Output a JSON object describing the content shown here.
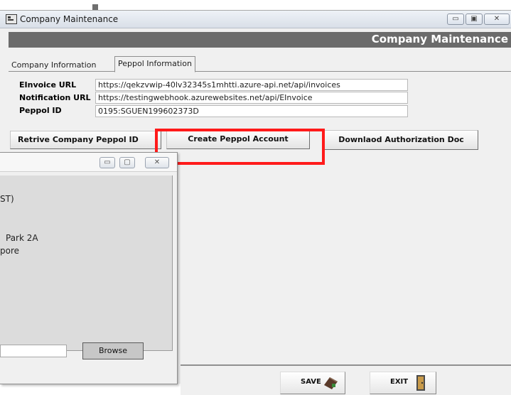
{
  "window": {
    "title": "Company Maintenance",
    "header": "Company Maintenance"
  },
  "tabs": [
    {
      "label": "Company Information",
      "active": false
    },
    {
      "label": "Peppol Information",
      "active": true
    }
  ],
  "peppol": {
    "einvoice_label": "EInvoice URL",
    "einvoice_value": "https://qekzvwip-40lv32345s1mhtti.azure-api.net/api/invoices",
    "notification_label": "Notification URL",
    "notification_value": "https://testingwebhook.azurewebsites.net/api/EInvoice",
    "peppol_id_label": "Peppol ID",
    "peppol_id_value": "0195:SGUEN199602373D"
  },
  "buttons": {
    "retrieve": "Retrive Company Peppol ID",
    "create": "Create Peppol Account",
    "download": "Downlaod Authorization Doc"
  },
  "child_window": {
    "line1": "ST)",
    "line2": "Park 2A",
    "line3": "pore",
    "browse_label": "Browse"
  },
  "footer": {
    "save_label": "SAVE",
    "exit_label": "EXIT"
  },
  "colors": {
    "highlight": "#ff1a1a",
    "header_bar": "#6b6b6b"
  }
}
